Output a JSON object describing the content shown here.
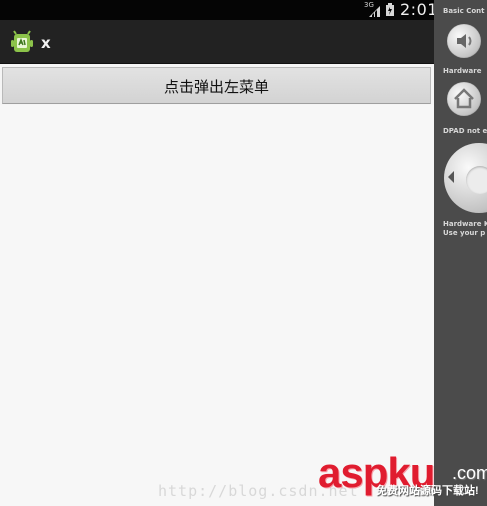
{
  "status_bar": {
    "network": "3G",
    "time": "2:01"
  },
  "app": {
    "title": "x"
  },
  "main": {
    "button_label": "点击弹出左菜单"
  },
  "emulator_controls": {
    "basic_label": "Basic Cont",
    "hardware_label": "Hardware",
    "dpad_label": "DPAD not e",
    "hardware_keys_line1": "Hardware K",
    "hardware_keys_line2": "Use your p"
  },
  "watermarks": {
    "blog_url": "http://blog.csdn.net",
    "site_logo": "aspku",
    "site_com": ".com",
    "site_slogan": "免费网站源码下载站!"
  },
  "colors": {
    "status_bar": "#050505",
    "action_bar": "#222222",
    "content": "#f7f7f7",
    "button": "#d8d8d8",
    "control_panel": "#4b4b4b",
    "logo_red": "#e01c2f"
  },
  "icons": {
    "signal": "signal-icon",
    "battery": "battery-icon",
    "app": "android-app-icon",
    "volume": "volume-icon",
    "home": "home-icon",
    "dpad": "dpad-icon"
  }
}
